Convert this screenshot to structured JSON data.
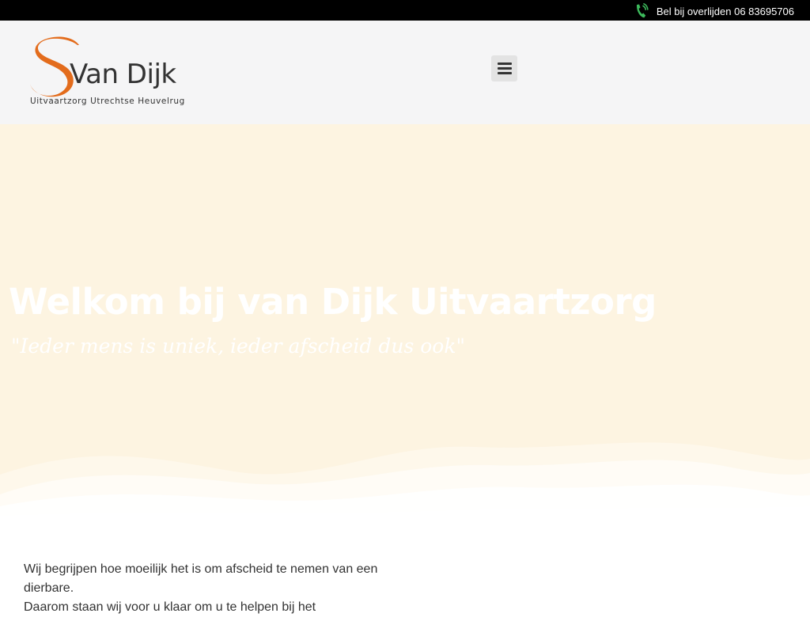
{
  "topbar": {
    "phone_icon": "phone-ringing-icon",
    "phone_text": "Bel bij overlijden 06 83695706",
    "icon_color": "#3dba5c"
  },
  "header": {
    "logo": {
      "name": "Van Dijk",
      "subtitle": "Uitvaartzorg Utrechtse Heuvelrug",
      "accent_color": "#e36c1c"
    },
    "menu_icon": "hamburger-menu-icon"
  },
  "hero": {
    "title": "Welkom bij van Dijk Uitvaartzorg",
    "quote": "\"Ieder mens is uniek, ieder afscheid dus ook\"",
    "background_color": "#fdf4e1"
  },
  "intro": {
    "lines": [
      "Wij begrijpen hoe moeilijk het is om afscheid te nemen van een dierbare.",
      "Daarom staan wij voor u klaar om u te helpen bij het"
    ]
  }
}
